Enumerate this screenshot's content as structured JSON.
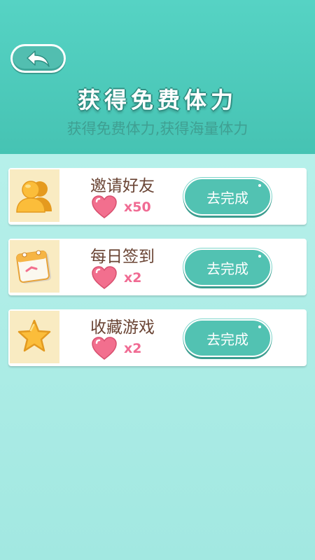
{
  "header": {
    "back_icon": "back-arrow-icon",
    "title": "获得免费体力",
    "subtitle": "获得免费体力,获得海量体力"
  },
  "tasks": [
    {
      "icon": "friends-icon",
      "label": "邀请好友",
      "reward_icon": "heart-icon",
      "reward": "x50",
      "button": "去完成"
    },
    {
      "icon": "calendar-icon",
      "label": "每日签到",
      "reward_icon": "heart-icon",
      "reward": "x2",
      "button": "去完成"
    },
    {
      "icon": "star-icon",
      "label": "收藏游戏",
      "reward_icon": "heart-icon",
      "reward": "x2",
      "button": "去完成"
    }
  ],
  "colors": {
    "header_bg": "#4ccbbb",
    "content_bg": "#a8ece6",
    "button_bg": "#52c2b2",
    "reward_text": "#f06b93",
    "label_text": "#6a4434"
  }
}
